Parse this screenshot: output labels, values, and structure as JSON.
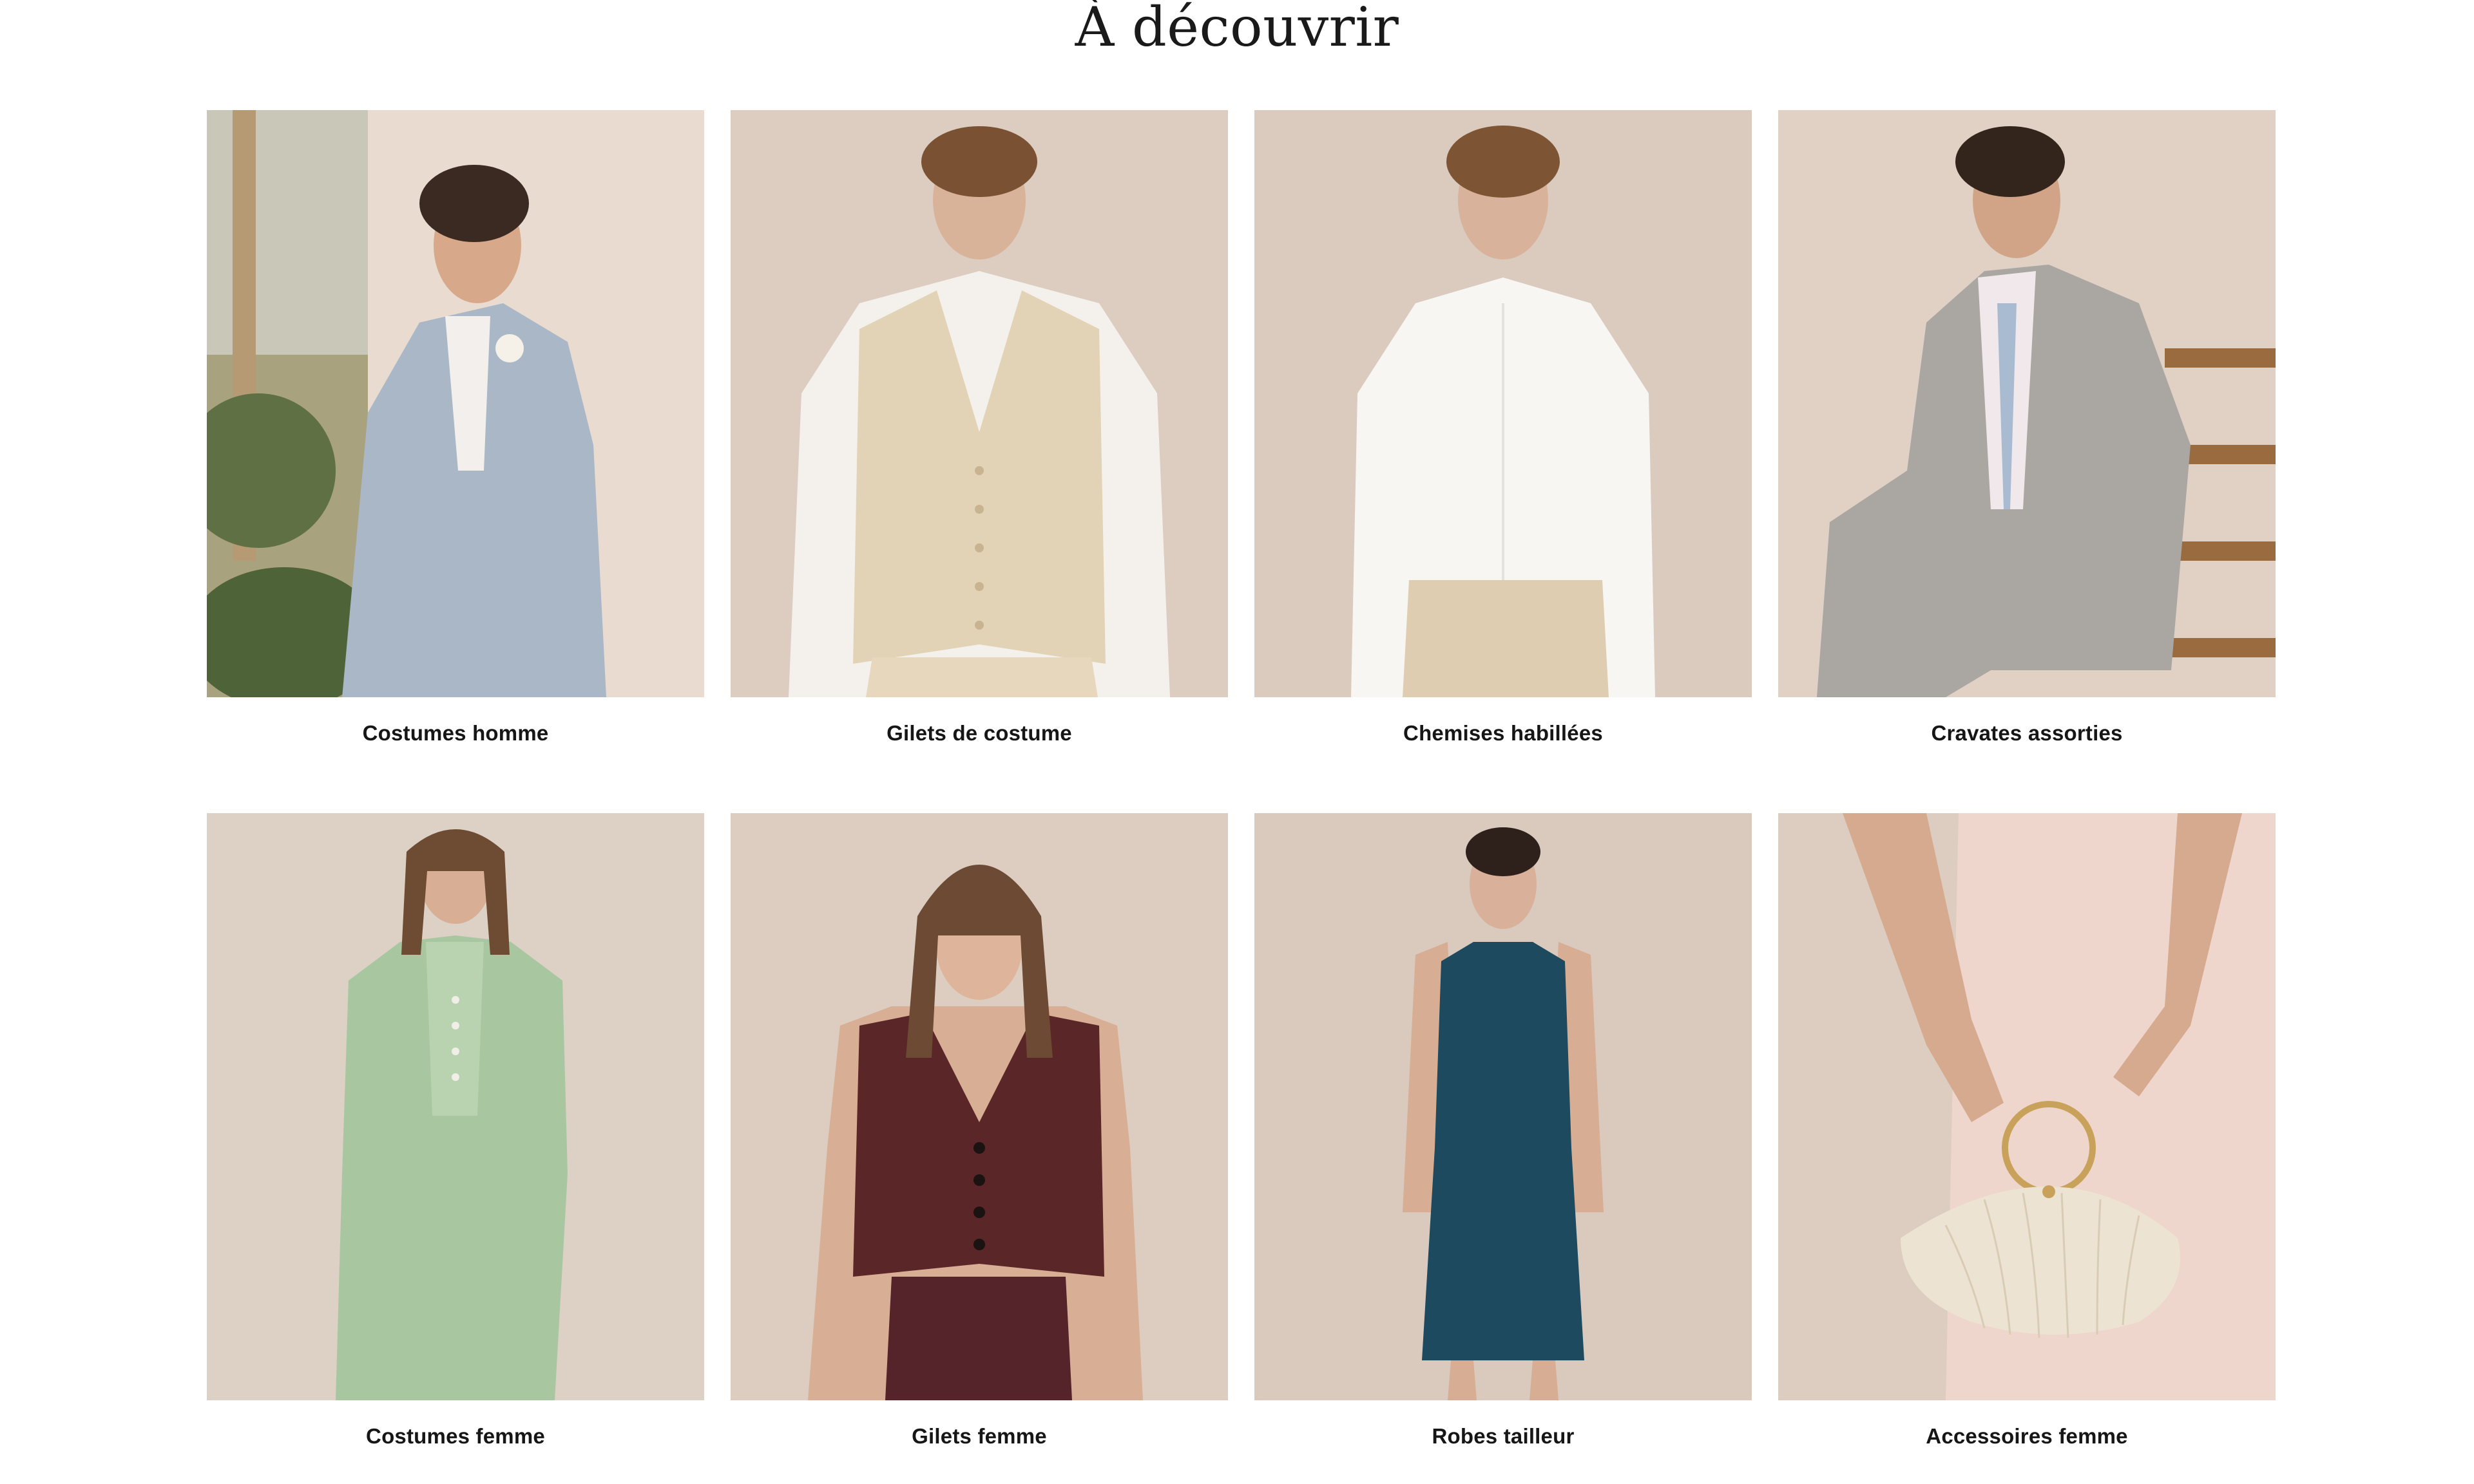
{
  "section": {
    "title": "À découvrir"
  },
  "categories": [
    {
      "label": "Costumes homme",
      "image": "man-light-blue-suit-leaning-wall"
    },
    {
      "label": "Gilets de costume",
      "image": "man-beige-suit-vest"
    },
    {
      "label": "Chemises habillées",
      "image": "man-white-dress-shirt"
    },
    {
      "label": "Cravates assorties",
      "image": "man-grey-suit-seated-stairs"
    },
    {
      "label": "Costumes femme",
      "image": "woman-sage-green-suit"
    },
    {
      "label": "Gilets femme",
      "image": "woman-burgundy-vest"
    },
    {
      "label": "Robes tailleur",
      "image": "woman-navy-sheath-dress"
    },
    {
      "label": "Accessoires femme",
      "image": "ivory-pleated-clutch"
    }
  ],
  "colors": {
    "background": "#ffffff",
    "text": "#161616",
    "studio_backdrop": "#d8c9bb"
  }
}
